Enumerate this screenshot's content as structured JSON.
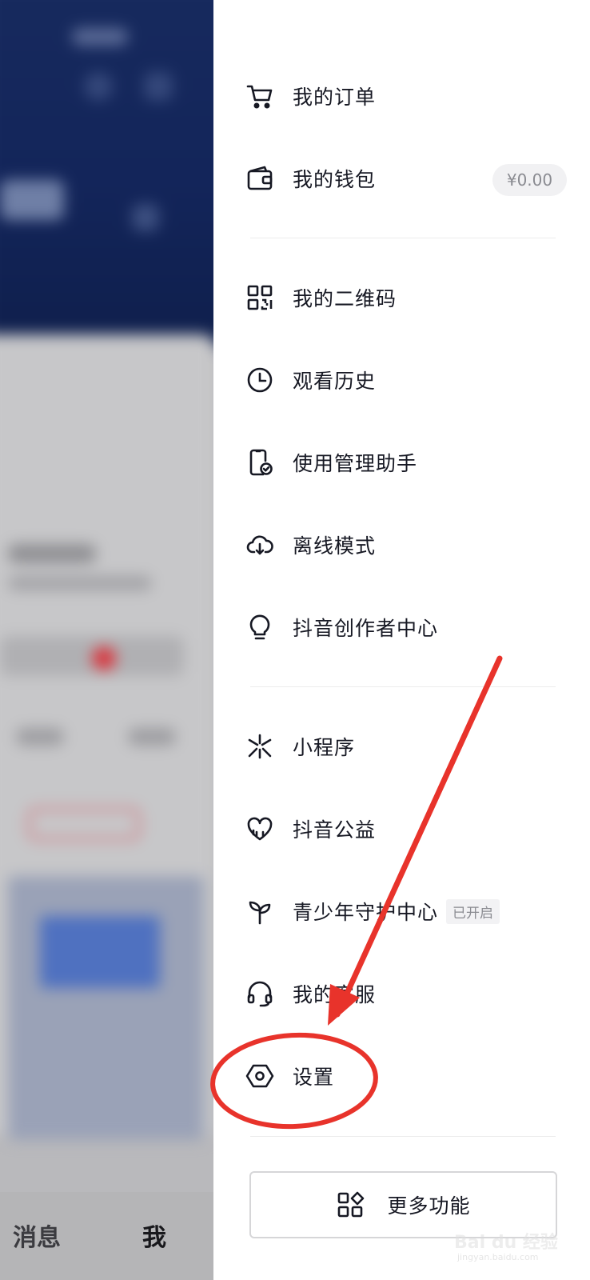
{
  "background_app": {
    "tabs": {
      "messages_label": "消息",
      "me_label": "我"
    }
  },
  "drawer": {
    "sections": [
      {
        "items": [
          {
            "label": "我的订单",
            "icon": "shopping-cart-icon"
          },
          {
            "label": "我的钱包",
            "icon": "wallet-icon",
            "badge": "¥0.00"
          }
        ]
      },
      {
        "items": [
          {
            "label": "我的二维码",
            "icon": "qr-code-icon"
          },
          {
            "label": "观看历史",
            "icon": "clock-icon"
          },
          {
            "label": "使用管理助手",
            "icon": "phone-check-icon"
          },
          {
            "label": "离线模式",
            "icon": "cloud-download-icon"
          },
          {
            "label": "抖音创作者中心",
            "icon": "lightbulb-icon"
          }
        ]
      },
      {
        "items": [
          {
            "label": "小程序",
            "icon": "mini-program-icon"
          },
          {
            "label": "抖音公益",
            "icon": "heart-charity-icon"
          },
          {
            "label": "青少年守护中心",
            "icon": "sprout-icon",
            "tag": "已开启"
          },
          {
            "label": "我的客服",
            "icon": "headset-icon"
          },
          {
            "label": "设置",
            "icon": "settings-hex-icon"
          }
        ]
      }
    ],
    "more_button": {
      "label": "更多功能",
      "icon": "grid-apps-icon"
    }
  },
  "annotation": {
    "color": "#e8332b",
    "highlighted_item": "设置"
  },
  "watermark": {
    "text": "Bai du 经验",
    "subtext": "jingyan.baidu.com"
  },
  "colors": {
    "text_primary": "#161823",
    "text_secondary": "#8a8b91",
    "divider": "#ececec",
    "badge_bg": "#f1f1f3"
  }
}
